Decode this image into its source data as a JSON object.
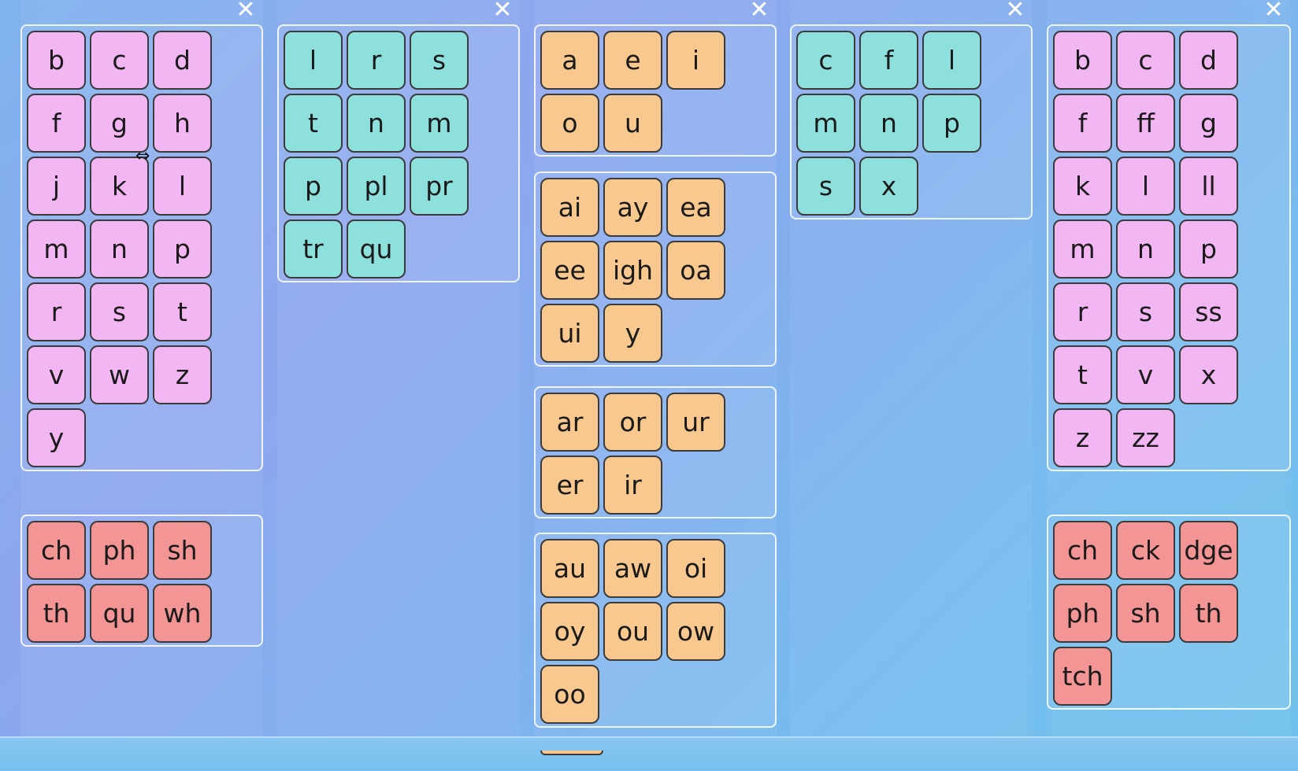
{
  "columns": [
    {
      "close_label": "✕",
      "groups": [
        {
          "color": "pink",
          "tiles": [
            "b",
            "c",
            "d",
            "f",
            "g",
            "h",
            "j",
            "k",
            "l",
            "m",
            "n",
            "p",
            "r",
            "s",
            "t",
            "v",
            "w",
            "z",
            "y"
          ]
        },
        {
          "color": "red",
          "tiles": [
            "ch",
            "ph",
            "sh",
            "th",
            "qu",
            "wh"
          ]
        }
      ]
    },
    {
      "close_label": "✕",
      "groups": [
        {
          "color": "teal",
          "tiles": [
            "l",
            "r",
            "s",
            "t",
            "n",
            "m",
            "p",
            "pl",
            "pr",
            "tr",
            "qu"
          ]
        }
      ]
    },
    {
      "close_label": "✕",
      "groups": [
        {
          "color": "orange",
          "tiles": [
            "a",
            "e",
            "i",
            "o",
            "u"
          ]
        },
        {
          "color": "orange",
          "tiles": [
            "ai",
            "ay",
            "ea",
            "ee",
            "igh",
            "oa",
            "ui",
            "y"
          ]
        },
        {
          "color": "orange",
          "tiles": [
            "ar",
            "or",
            "ur",
            "er",
            "ir"
          ]
        },
        {
          "color": "orange",
          "tiles": [
            "au",
            "aw",
            "oi",
            "oy",
            "ou",
            "ow",
            "oo"
          ]
        }
      ]
    },
    {
      "close_label": "✕",
      "groups": [
        {
          "color": "teal",
          "tiles": [
            "c",
            "f",
            "l",
            "m",
            "n",
            "p",
            "s",
            "x"
          ]
        }
      ]
    },
    {
      "close_label": "✕",
      "groups": [
        {
          "color": "pink",
          "tiles": [
            "b",
            "c",
            "d",
            "f",
            "ff",
            "g",
            "k",
            "l",
            "ll",
            "m",
            "n",
            "p",
            "r",
            "s",
            "ss",
            "t",
            "v",
            "x",
            "z",
            "zz"
          ]
        },
        {
          "color": "red",
          "tiles": [
            "ch",
            "ck",
            "dge",
            "ph",
            "sh",
            "th",
            "tch"
          ]
        }
      ]
    }
  ],
  "colors": {
    "pink": "#f2b6f2",
    "teal": "#8ee0dc",
    "orange": "#f8c88e",
    "red": "#f39595"
  },
  "cursor": "resize-horizontal-cursor"
}
